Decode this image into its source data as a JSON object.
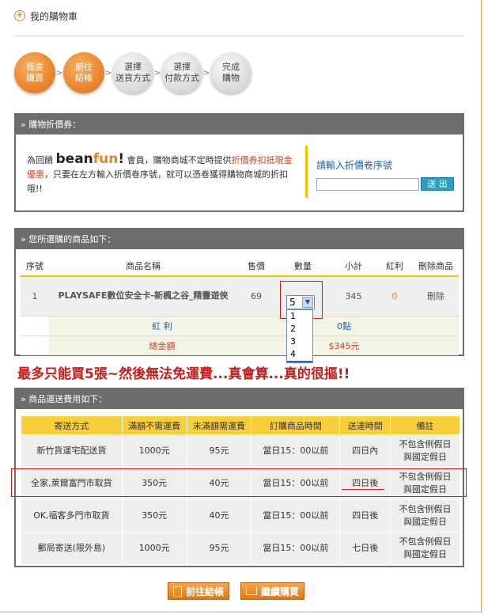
{
  "title": "我的購物車",
  "steps": [
    {
      "line1": "我要",
      "line2": "購買"
    },
    {
      "line1": "前往",
      "line2": "結帳"
    },
    {
      "line1": "選擇",
      "line2": "送貨方式"
    },
    {
      "line1": "選擇",
      "line2": "付款方式"
    },
    {
      "line1": "完成",
      "line2": "購物"
    }
  ],
  "step_arrow": ">",
  "coupon": {
    "header": "» 購物折價券：",
    "text_a": "為回饋",
    "brand_a": "bean",
    "brand_b": "fun",
    "brand_c": "!",
    "text_b": " 會員，購物商城不定時提供",
    "highlight": "折價券扣抵現金優惠",
    "text_c": "，只要在左方輸入折價卷序號，就可以憑卷獲得購物商城的折扣哦!!",
    "input_label": "請輸入折價卷序號",
    "input_value": "",
    "send_button": "送 出"
  },
  "goods": {
    "header": "» 您所選購的商品如下：",
    "columns": [
      "序號",
      "商品名稱",
      "售價",
      "數量",
      "小計",
      "紅利",
      "刪除商品"
    ],
    "item": {
      "no": "1",
      "name": "PLAYSAFE數位安全卡-新楓之谷_精靈遊俠",
      "price": "69",
      "qty": "5",
      "subtotal": "345",
      "bonus": "0",
      "delete": "刪除"
    },
    "qty_options": [
      "1",
      "2",
      "3",
      "4",
      "5"
    ],
    "bonus_label": "紅 利",
    "bonus_value": "0點",
    "total_label": "總金額",
    "total_value": "$345元"
  },
  "note": "最多只能買5張~然後無法免運費...真會算...真的很摳!!",
  "shipping": {
    "header": "» 商品運送費用如下：",
    "columns": [
      "寄送方式",
      "滿額不需運費",
      "未滿額需運費",
      "訂購商品時間",
      "送達時間",
      "備註"
    ],
    "rows": [
      {
        "method": "新竹貨運宅配送貨",
        "free": "1000元",
        "fee": "95元",
        "order_time": "當日15：00以前",
        "arrive": "四日內",
        "remark1": "不包含例假日",
        "remark2": "與國定假日"
      },
      {
        "method": "全家,萊爾富門市取貨",
        "free": "350元",
        "fee": "40元",
        "order_time": "當日15：00以前",
        "arrive": "四日後",
        "remark1": "不包含例假日",
        "remark2": "與國定假日"
      },
      {
        "method": "OK,福客多門市取貨",
        "free": "350元",
        "fee": "40元",
        "order_time": "當日15：00以前",
        "arrive": "四日後",
        "remark1": "不包含例假日",
        "remark2": "與國定假日"
      },
      {
        "method": "郵局寄送(限外島)",
        "free": "1000元",
        "fee": "95元",
        "order_time": "當日15：00以前",
        "arrive": "七日後",
        "remark1": "不包含例假日",
        "remark2": "與國定假日"
      }
    ]
  },
  "buttons": {
    "checkout": "前往結帳",
    "continue": "繼續購買"
  },
  "colors": {
    "accent": "#e8801e",
    "header_gray": "#6d6d6d",
    "highlight_red": "#d21c1c",
    "table_yellow": "#f7cf3a"
  }
}
